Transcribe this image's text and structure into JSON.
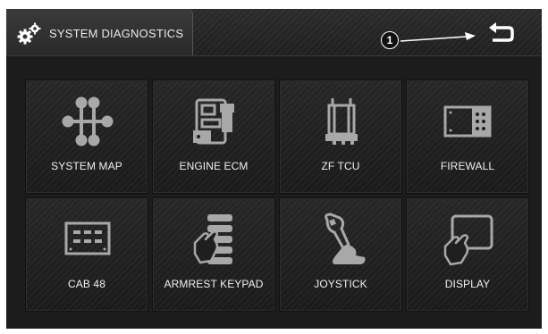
{
  "header": {
    "title": "SYSTEM DIAGNOSTICS",
    "title_icon": "gears-icon",
    "annotation_number": "1",
    "back_icon": "back-arrow-icon"
  },
  "tiles": [
    {
      "label": "SYSTEM MAP",
      "icon": "system-map-icon"
    },
    {
      "label": "ENGINE ECM",
      "icon": "engine-ecm-icon"
    },
    {
      "label": "ZF TCU",
      "icon": "zf-tcu-icon"
    },
    {
      "label": "FIREWALL",
      "icon": "firewall-icon"
    },
    {
      "label": "CAB 48",
      "icon": "cab-48-icon"
    },
    {
      "label": "ARMREST KEYPAD",
      "icon": "armrest-keypad-icon"
    },
    {
      "label": "JOYSTICK",
      "icon": "joystick-icon"
    },
    {
      "label": "DISPLAY",
      "icon": "display-icon"
    }
  ],
  "colors": {
    "background": "#1c1c1c",
    "icon_gray": "#a8a8a8",
    "text": "#f0f0f0",
    "annotation": "#ffffff"
  }
}
